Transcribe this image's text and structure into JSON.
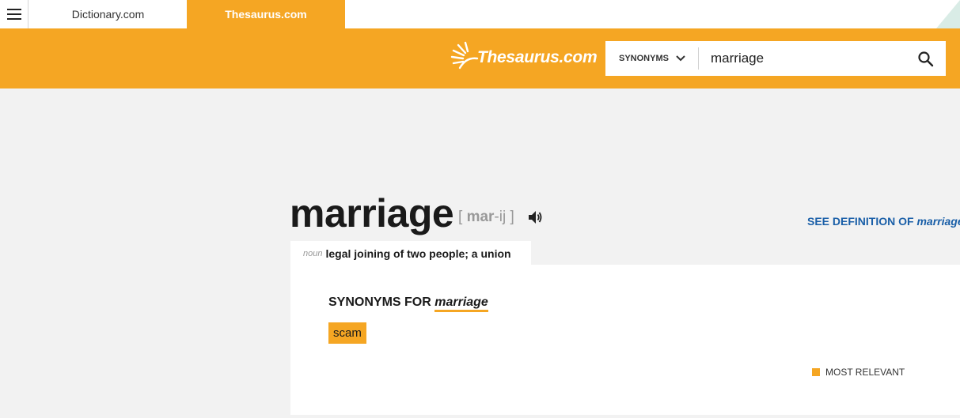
{
  "topbar": {
    "tabs": [
      {
        "label": "Dictionary.com"
      },
      {
        "label": "Thesaurus.com",
        "active": true
      }
    ]
  },
  "header": {
    "logo_text": "Thesaurus.com",
    "search": {
      "mode_label": "SYNONYMS",
      "value": "marriage"
    }
  },
  "entry": {
    "word": "marriage",
    "pronunciation": {
      "open": "[",
      "stressed": "mar",
      "rest": "-ij",
      "close": "]"
    },
    "see_definition_prefix": "SEE DEFINITION OF ",
    "see_definition_word": "marriage",
    "part_of_speech": "noun",
    "sense": "legal joining of two people; a union",
    "synonyms_heading_prefix": "SYNONYMS FOR ",
    "synonyms_heading_word": "marriage",
    "synonyms": [
      "scam"
    ],
    "legend_label": "MOST RELEVANT"
  },
  "colors": {
    "brand": "#f5a623",
    "link": "#1a5fa8"
  },
  "icons": {
    "menu": "hamburger-menu-icon",
    "logo": "sunburst-logo-icon",
    "dropdown": "chevron-down-icon",
    "search": "search-icon",
    "audio": "speaker-icon"
  }
}
